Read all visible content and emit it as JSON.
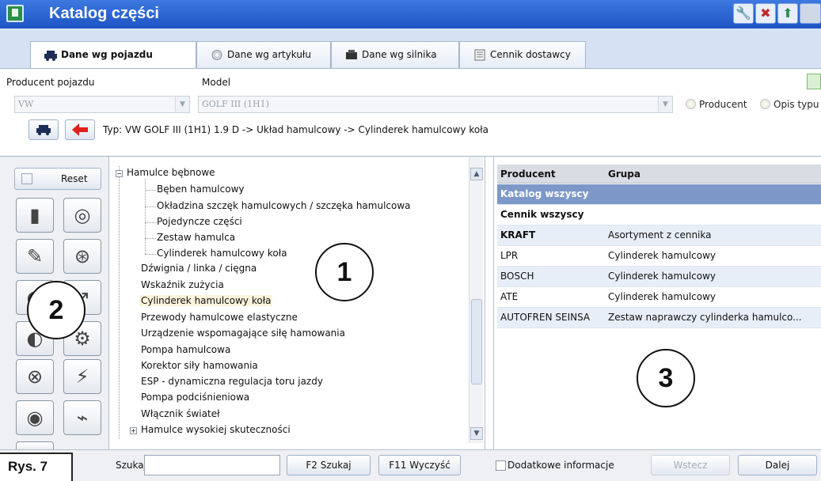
{
  "window": {
    "title": "Katalog części"
  },
  "tabs": [
    {
      "label": "Dane wg pojazdu",
      "active": true
    },
    {
      "label": "Dane wg artykułu",
      "active": false
    },
    {
      "label": "Dane wg silnika",
      "active": false
    },
    {
      "label": "Cennik dostawcy",
      "active": false
    }
  ],
  "vehicle": {
    "manufacturer_label": "Producent pojazdu",
    "manufacturer_value": "VW",
    "model_label": "Model",
    "model_value": "GOLF III (1H1)",
    "radio_producer": "Producent",
    "radio_type": "Opis typu",
    "breadcrumb": "Typ: VW GOLF III (1H1) 1.9 D -> Układ hamulcowy -> Cylinderek hamulcowy koła"
  },
  "left": {
    "reset_label": "Reset"
  },
  "tree": {
    "items": [
      "Hamulce bębnowe",
      "Bęben hamulcowy",
      "Okładzina szczęk hamulcowych / szczęka hamulcowa",
      "Pojedyncze części",
      "Zestaw hamulca",
      "Cylinderek hamulcowy koła",
      "Dźwignia / linka / cięgna",
      "Wskaźnik zużycia",
      "Cylinderek hamulcowy koła",
      "Przewody hamulcowe elastyczne",
      "Urządzenie wspomagające siłę hamowania",
      "Pompa hamulcowa",
      "Korektor siły hamowania",
      "ESP - dynamiczna regulacja toru jazdy",
      "Pompa podciśnieniowa",
      "Włącznik świateł",
      "Hamulce wysokiej skuteczności"
    ]
  },
  "grid": {
    "headers": [
      "Producent",
      "Grupa"
    ],
    "rows": [
      [
        "Katalog wszyscy",
        ""
      ],
      [
        "Cennik wszyscy",
        ""
      ],
      [
        "KRAFT",
        "Asortyment z cennika"
      ],
      [
        "LPR",
        "Cylinderek hamulcowy"
      ],
      [
        "BOSCH",
        "Cylinderek hamulcowy"
      ],
      [
        "ATE",
        "Cylinderek hamulcowy"
      ],
      [
        "AUTOFREN SEINSA",
        "Zestaw naprawczy cylinderka hamulco..."
      ]
    ]
  },
  "callouts": {
    "one": "1",
    "two": "2",
    "three": "3"
  },
  "bottom": {
    "search_label": "Szukaj",
    "search_value": "",
    "search_button": "F2 Szukaj",
    "clear_button": "F11 Wyczyść",
    "extra_info": "Dodatkowe informacje",
    "back_button": "Wstecz",
    "next_button": "Dalej"
  },
  "figure_label": "Rys. 7",
  "colors": {
    "titlebar": "#1d55c4",
    "selected_row": "#7d98c8",
    "selected_tree": "#fbf3dc"
  }
}
